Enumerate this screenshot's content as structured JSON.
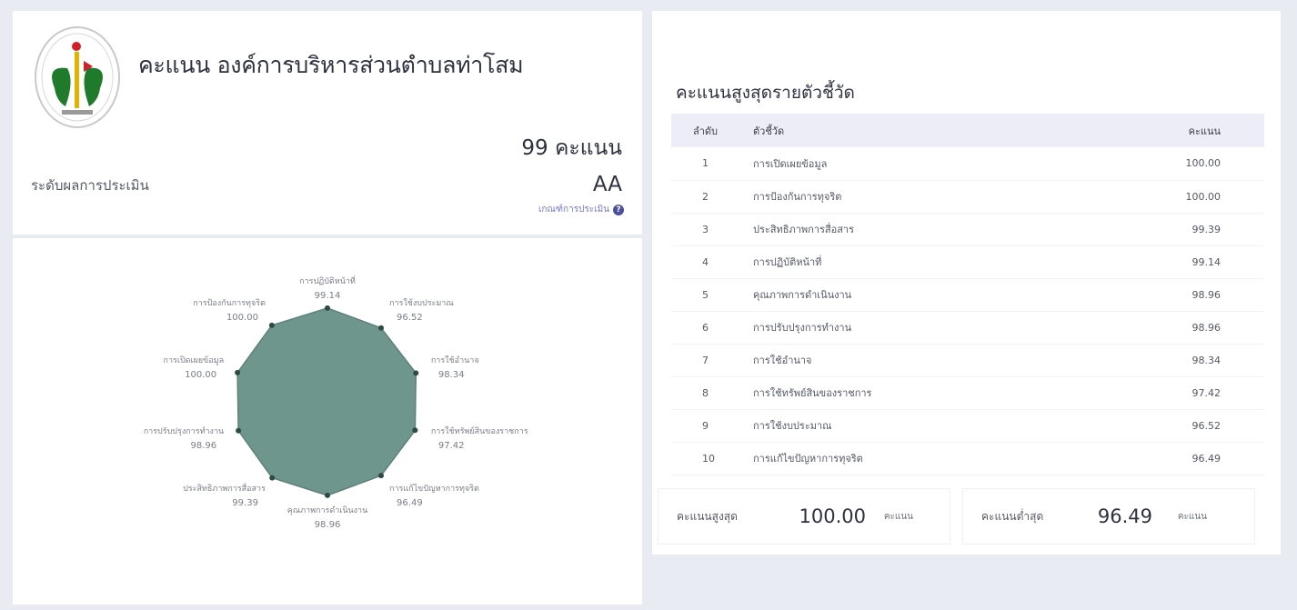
{
  "org": {
    "title": "คะแนน องค์การบริหารส่วนตำบลท่าโสม",
    "score_text": "99 คะแนน",
    "eval_label": "ระดับผลการประเมิน",
    "grade": "AA",
    "criteria_link": "เกณฑ์การประเมิน"
  },
  "table": {
    "title": "คะแนนสูงสุดรายตัวชี้วัด",
    "headers": {
      "rank": "ลำดับ",
      "indicator": "ตัวชี้วัด",
      "score": "คะแนน"
    },
    "rows": [
      {
        "rank": "1",
        "indicator": "การเปิดเผยข้อมูล",
        "score": "100.00"
      },
      {
        "rank": "2",
        "indicator": "การป้องกันการทุจริต",
        "score": "100.00"
      },
      {
        "rank": "3",
        "indicator": "ประสิทธิภาพการสื่อสาร",
        "score": "99.39"
      },
      {
        "rank": "4",
        "indicator": "การปฏิบัติหน้าที่",
        "score": "99.14"
      },
      {
        "rank": "5",
        "indicator": "คุณภาพการดำเนินงาน",
        "score": "98.96"
      },
      {
        "rank": "6",
        "indicator": "การปรับปรุงการทำงาน",
        "score": "98.96"
      },
      {
        "rank": "7",
        "indicator": "การใช้อำนาจ",
        "score": "98.34"
      },
      {
        "rank": "8",
        "indicator": "การใช้ทรัพย์สินของราชการ",
        "score": "97.42"
      },
      {
        "rank": "9",
        "indicator": "การใช้งบประมาณ",
        "score": "96.52"
      },
      {
        "rank": "10",
        "indicator": "การแก้ไขปัญหาการทุจริต",
        "score": "96.49"
      }
    ]
  },
  "summary": {
    "max_label": "คะแนนสูงสุด",
    "max_value": "100.00",
    "min_label": "คะแนนต่ำสุด",
    "min_value": "96.49",
    "unit": "คะแนน"
  },
  "chart_data": {
    "type": "radar",
    "axes": [
      {
        "label": "การปฏิบัติหน้าที่",
        "value": 99.14
      },
      {
        "label": "การใช้งบประมาณ",
        "value": 96.52
      },
      {
        "label": "การใช้อำนาจ",
        "value": 98.34
      },
      {
        "label": "การใช้ทรัพย์สินของราชการ",
        "value": 97.42
      },
      {
        "label": "การแก้ไขปัญหาการทุจริต",
        "value": 96.49
      },
      {
        "label": "คุณภาพการดำเนินงาน",
        "value": 98.96
      },
      {
        "label": "ประสิทธิภาพการสื่อสาร",
        "value": 99.39
      },
      {
        "label": "การปรับปรุงการทำงาน",
        "value": 98.96
      },
      {
        "label": "การเปิดเผยข้อมูล",
        "value": 100.0
      },
      {
        "label": "การป้องกันการทุจริต",
        "value": 100.0
      }
    ],
    "rlim": [
      0,
      100
    ],
    "fill_color": "#6f968d",
    "stroke_color": "#5d8178",
    "point_color": "#2f4a43"
  }
}
